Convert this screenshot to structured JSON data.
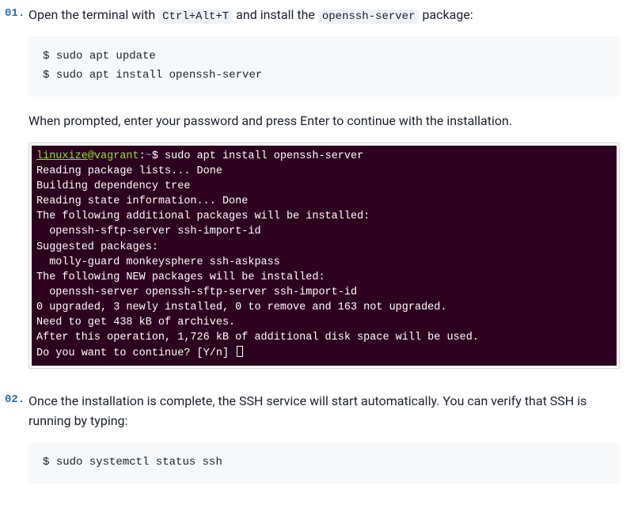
{
  "steps": [
    {
      "intro_parts": [
        "Open the terminal with ",
        "Ctrl+Alt+T",
        " and install the ",
        "openssh-server",
        " package:"
      ],
      "commands": [
        "sudo apt update",
        "sudo apt install openssh-server"
      ],
      "prompt_char": "$",
      "follow_text": "When prompted, enter your password and press Enter to continue with the installation.",
      "terminal": {
        "user": "linuxize",
        "host": "vagrant",
        "path": "~",
        "cmd": "sudo apt install openssh-server",
        "lines": [
          "Reading package lists... Done",
          "Building dependency tree",
          "Reading state information... Done",
          "The following additional packages will be installed:",
          "  openssh-sftp-server ssh-import-id",
          "Suggested packages:",
          "  molly-guard monkeysphere ssh-askpass",
          "The following NEW packages will be installed:",
          "  openssh-server openssh-sftp-server ssh-import-id",
          "0 upgraded, 3 newly installed, 0 to remove and 163 not upgraded.",
          "Need to get 438 kB of archives.",
          "After this operation, 1,726 kB of additional disk space will be used.",
          "Do you want to continue? [Y/n] "
        ]
      }
    },
    {
      "intro_text": "Once the installation is complete, the SSH service will start automatically. You can verify that SSH is running by typing:",
      "commands": [
        "sudo systemctl status ssh"
      ],
      "prompt_char": "$"
    }
  ]
}
